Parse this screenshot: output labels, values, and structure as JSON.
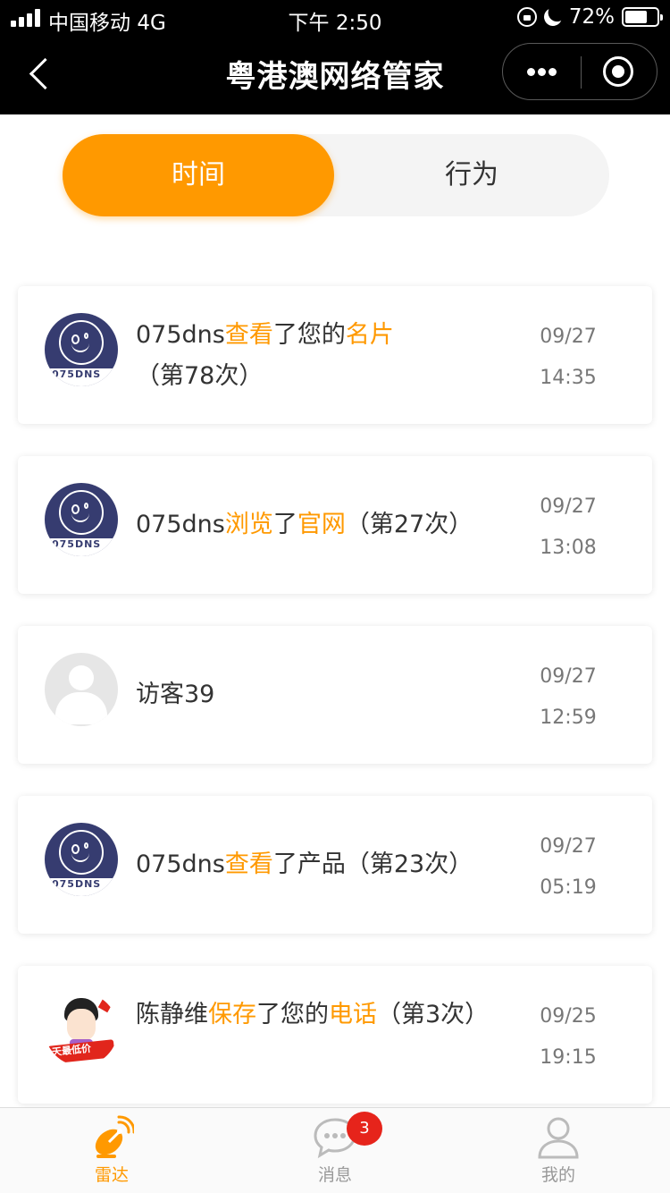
{
  "status_bar": {
    "carrier": "中国移动",
    "network": "4G",
    "time": "下午 2:50",
    "battery": "72%",
    "battery_level": 0.72
  },
  "nav": {
    "title": "粤港澳网络管家",
    "back_icon": "chevron-left-icon",
    "more_icon": "more-dots-icon",
    "close_icon": "target-circle-icon"
  },
  "segments": {
    "active": "时间",
    "inactive": "行为"
  },
  "colors": {
    "accent": "#ff9900",
    "badge": "#e6241b",
    "header": "#000000"
  },
  "records": [
    {
      "avatar": "avatar-075dns",
      "avatar_text": "075DNS",
      "parts": [
        "075dns",
        "查看",
        "了您的",
        "名片",
        "（第78次）"
      ],
      "date": "09/27",
      "time": "14:35"
    },
    {
      "avatar": "avatar-075dns",
      "avatar_text": "075DNS",
      "parts": [
        "075dns",
        "浏览",
        "了",
        "官网",
        "（第27次）"
      ],
      "date": "09/27",
      "time": "13:08"
    },
    {
      "avatar": "avatar-guest",
      "parts": [
        "访客39"
      ],
      "date": "09/27",
      "time": "12:59"
    },
    {
      "avatar": "avatar-075dns",
      "avatar_text": "075DNS",
      "parts": [
        "075dns",
        "查看",
        "了产品（第23次）"
      ],
      "date": "09/27",
      "time": "05:19"
    },
    {
      "avatar": "avatar-person",
      "avatar_text": "天最低价",
      "parts": [
        "陈静维",
        "保存",
        "了您的",
        "电话",
        "（第3次）"
      ],
      "date": "09/25",
      "time": "19:15"
    }
  ],
  "tabbar": [
    {
      "label": "雷达",
      "icon": "radar-dish-icon",
      "active": true
    },
    {
      "label": "消息",
      "icon": "chat-bubble-icon",
      "badge": "3"
    },
    {
      "label": "我的",
      "icon": "user-icon"
    }
  ]
}
